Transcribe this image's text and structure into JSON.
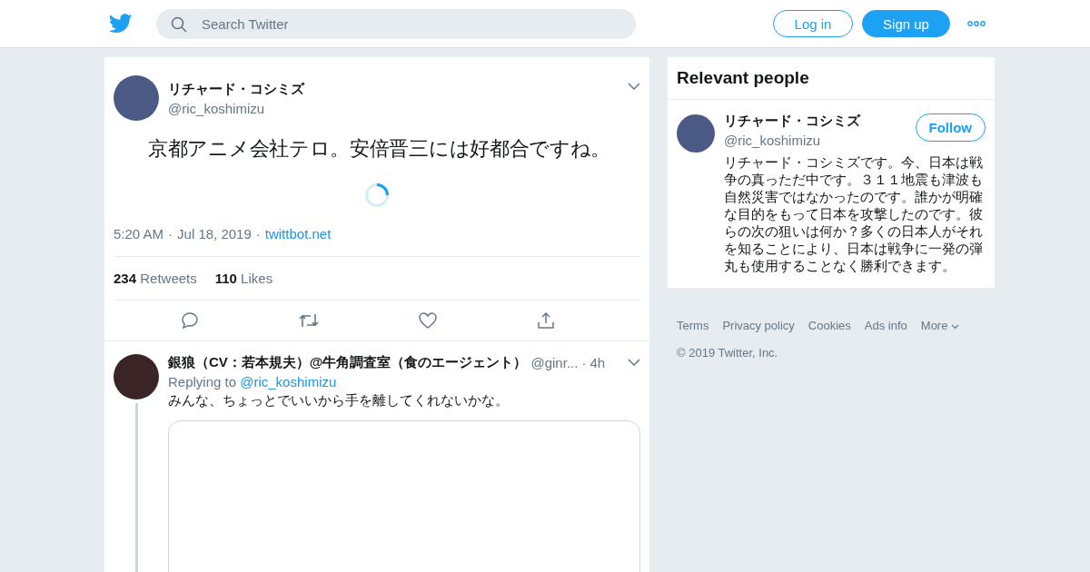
{
  "header": {
    "search": {
      "placeholder": "Search Twitter"
    },
    "login": "Log in",
    "signup": "Sign up"
  },
  "tweet": {
    "name": "リチャード・コシミズ",
    "handle": "@ric_koshimizu",
    "text": "京都アニメ会社テロ。安倍晋三には好都合ですね。",
    "time": "5:20 AM",
    "separator": "·",
    "date": "Jul 18, 2019",
    "source": "twittbot.net",
    "retweets": "234",
    "retweets_label": "Retweets",
    "likes": "110",
    "likes_label": "Likes"
  },
  "reply": {
    "name": "銀狼（CV：若本規夫）@牛角調査室（食のエージェント）",
    "handle": "@ginr...",
    "separator": "·",
    "age": "4h",
    "replying_label": "Replying to",
    "replying_to": "@ric_koshimizu",
    "text": "みんな、ちょっとでいいから手を離してくれないかな。"
  },
  "relevant": {
    "title": "Relevant people",
    "person": {
      "name": "リチャード・コシミズ",
      "handle": "@ric_koshimizu",
      "follow": "Follow",
      "bio": "リチャード・コシミズです。今、日本は戦争の真っただ中です。３１１地震も津波も自然災害ではなかったのです。誰かが明確な目的をもって日本を攻撃したのです。彼らの次の狙いは何か？多くの日本人がそれを知ることにより、日本は戦争に一発の弾丸も使用することなく勝利できます。"
    }
  },
  "footer": {
    "links": [
      "Terms",
      "Privacy policy",
      "Cookies",
      "Ads info",
      "More"
    ],
    "copyright": "© 2019 Twitter, Inc."
  }
}
